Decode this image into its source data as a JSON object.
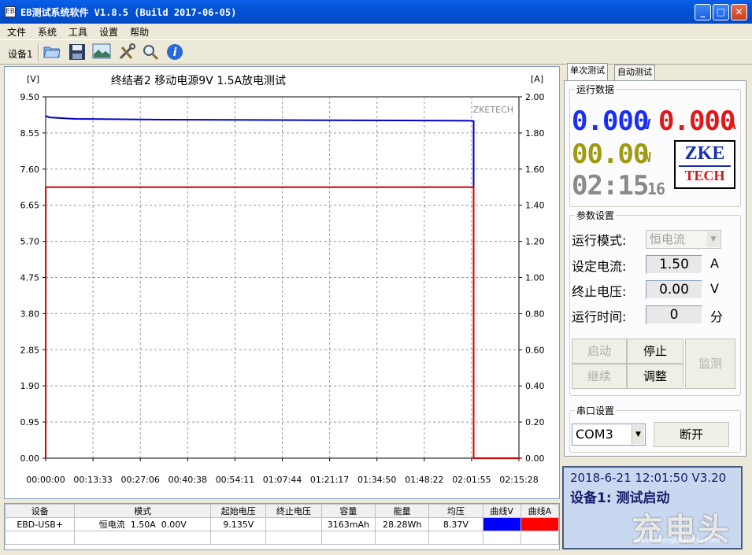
{
  "window": {
    "title": "EB测试系统软件 V1.8.5 (Build 2017-06-05)",
    "icon_label": "EB",
    "min": "_",
    "max": "□",
    "close": "✕"
  },
  "menu": [
    "文件",
    "系统",
    "工具",
    "设置",
    "帮助"
  ],
  "toolbar": {
    "device": "设备1",
    "icons": [
      "folder-open-icon",
      "save-icon",
      "picture-icon",
      "tools-icon",
      "search-icon",
      "info-icon"
    ]
  },
  "chart_data": {
    "type": "line",
    "title": "终结者2 移动电源9V 1.5A放电测试",
    "watermark": "ZKETECH",
    "ylabel_left": "[V]",
    "ylabel_right": "[A]",
    "ylim_left": [
      0,
      9.5
    ],
    "ylim_right": [
      0,
      2.0
    ],
    "yticks_left": [
      "9.50",
      "8.55",
      "7.60",
      "6.65",
      "5.70",
      "4.75",
      "3.80",
      "2.85",
      "1.90",
      "0.95",
      "0.00"
    ],
    "yticks_right": [
      "2.00",
      "1.80",
      "1.60",
      "1.40",
      "1.20",
      "1.00",
      "0.80",
      "0.60",
      "0.40",
      "0.20",
      "0.00"
    ],
    "xticks": [
      "00:00:00",
      "00:13:33",
      "00:27:06",
      "00:40:38",
      "00:54:11",
      "01:07:44",
      "01:21:17",
      "01:34:50",
      "01:48:22",
      "02:01:55",
      "02:15:28"
    ],
    "x_max_seconds": 8128,
    "series": [
      {
        "axis": "left",
        "color": "#0000cc",
        "x_seconds": [
          0,
          60,
          500,
          2000,
          4000,
          6000,
          7300,
          7350,
          7351
        ],
        "y": [
          9.0,
          8.96,
          8.92,
          8.9,
          8.89,
          8.88,
          8.87,
          8.86,
          0.0
        ]
      },
      {
        "axis": "right",
        "color": "#dd0000",
        "x_seconds": [
          0,
          1,
          7350,
          7351,
          8128
        ],
        "y": [
          0.0,
          1.5,
          1.5,
          0.0,
          0.0
        ]
      }
    ]
  },
  "table": {
    "headers": [
      "设备",
      "模式",
      "起始电压",
      "终止电压",
      "容量",
      "能量",
      "均压",
      "曲线V",
      "曲线A"
    ],
    "rows": [
      [
        "EBD-USB+",
        "恒电流  1.50A  0.00V",
        "9.135V",
        "",
        "3163mAh",
        "28.28Wh",
        "8.37V",
        "",
        ""
      ]
    ],
    "curve_colors": [
      "#0000ff",
      "#ff0000"
    ]
  },
  "right": {
    "tabs": [
      "单次测试",
      "自动测试"
    ],
    "run_data_title": "运行数据",
    "voltage": "0.000",
    "voltage_unit": "V",
    "current": "0.000",
    "current_unit": "A",
    "power": "00.00",
    "power_unit": "W",
    "time": "02:15",
    "time_sec": "16",
    "logo_line1": "ZKE",
    "logo_line2": "TECH",
    "params_title": "参数设置",
    "mode_label": "运行模式:",
    "mode_value": "恒电流",
    "current_label": "设定电流:",
    "current_value": "1.50",
    "current_set_unit": "A",
    "stopv_label": "终止电压:",
    "stopv_value": "0.00",
    "stopv_unit": "V",
    "time_label": "运行时间:",
    "time_value": "0",
    "time_unit": "分",
    "btn_start": "启动",
    "btn_stop": "停止",
    "btn_continue": "继续",
    "btn_adjust": "调整",
    "btn_monitor": "监测",
    "serial_title": "串口设置",
    "com_value": "COM3",
    "btn_disconnect": "断开",
    "colors": {
      "voltage": "#1a2ff0",
      "current": "#e01818",
      "power": "#a09a10",
      "time": "#8a8a8a"
    }
  },
  "status": {
    "line1": "2018-6-21 12:01:50  V3.20",
    "line2": "设备1: 测试启动"
  },
  "watermark_brand": {
    "text": "充电头",
    "url": "www.chongdiantou.com"
  }
}
